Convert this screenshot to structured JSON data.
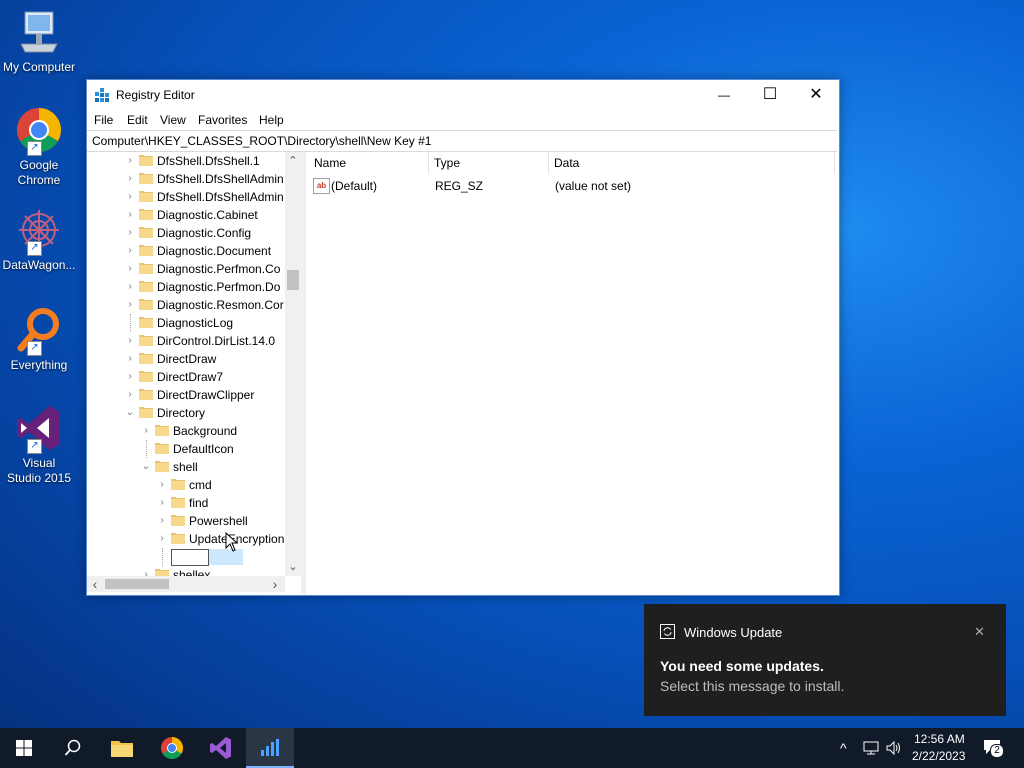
{
  "desktop": {
    "icons": [
      {
        "label": "My Computer",
        "icon": "computer-icon"
      },
      {
        "label": "Google Chrome",
        "icon": "chrome-icon"
      },
      {
        "label": "DataWagon...",
        "icon": "datawagon-icon"
      },
      {
        "label": "Everything",
        "icon": "everything-icon"
      },
      {
        "label": "Visual Studio 2015",
        "icon": "visual-studio-icon"
      }
    ]
  },
  "window": {
    "title": "Registry Editor",
    "controls": {
      "minimize": "—",
      "maximize": "☐",
      "close": "✕"
    },
    "menu": [
      "File",
      "Edit",
      "View",
      "Favorites",
      "Help"
    ],
    "address": "Computer\\HKEY_CLASSES_ROOT\\Directory\\shell\\New Key #1",
    "tree": [
      {
        "label": "DfsShell.DfsShell.1",
        "depth": 0,
        "expander": "›"
      },
      {
        "label": "DfsShell.DfsShellAdmin",
        "depth": 0,
        "expander": "›"
      },
      {
        "label": "DfsShell.DfsShellAdmin",
        "depth": 0,
        "expander": "›"
      },
      {
        "label": "Diagnostic.Cabinet",
        "depth": 0,
        "expander": "›"
      },
      {
        "label": "Diagnostic.Config",
        "depth": 0,
        "expander": "›"
      },
      {
        "label": "Diagnostic.Document",
        "depth": 0,
        "expander": "›"
      },
      {
        "label": "Diagnostic.Perfmon.Co",
        "depth": 0,
        "expander": "›"
      },
      {
        "label": "Diagnostic.Perfmon.Do",
        "depth": 0,
        "expander": "›"
      },
      {
        "label": "Diagnostic.Resmon.Cor",
        "depth": 0,
        "expander": "›"
      },
      {
        "label": "DiagnosticLog",
        "depth": 0,
        "expander": ""
      },
      {
        "label": "DirControl.DirList.14.0",
        "depth": 0,
        "expander": "›"
      },
      {
        "label": "DirectDraw",
        "depth": 0,
        "expander": "›"
      },
      {
        "label": "DirectDraw7",
        "depth": 0,
        "expander": "›"
      },
      {
        "label": "DirectDrawClipper",
        "depth": 0,
        "expander": "›"
      },
      {
        "label": "Directory",
        "depth": 0,
        "expander": "⌄"
      },
      {
        "label": "Background",
        "depth": 1,
        "expander": "›"
      },
      {
        "label": "DefaultIcon",
        "depth": 1,
        "expander": ""
      },
      {
        "label": "shell",
        "depth": 1,
        "expander": "⌄"
      },
      {
        "label": "cmd",
        "depth": 2,
        "expander": "›"
      },
      {
        "label": "find",
        "depth": 2,
        "expander": "›"
      },
      {
        "label": "Powershell",
        "depth": 2,
        "expander": "›"
      },
      {
        "label": "UpdateEncryption",
        "depth": 2,
        "expander": "›"
      },
      {
        "label": "",
        "depth": 2,
        "expander": "",
        "editing": true
      },
      {
        "label": "shellex",
        "depth": 1,
        "expander": "›"
      }
    ],
    "scroll": {
      "left": "‹",
      "right": "›",
      "up": "⌃",
      "down": "⌄"
    },
    "list": {
      "columns": [
        "Name",
        "Type",
        "Data"
      ],
      "rows": [
        {
          "name": "(Default)",
          "type": "REG_SZ",
          "data": "(value not set)"
        }
      ]
    }
  },
  "toast": {
    "app": "Windows Update",
    "title": "You need some updates.",
    "body": "Select this message to install.",
    "close": "✕"
  },
  "taskbar": {
    "apps": [
      "start-icon",
      "search-icon",
      "file-explorer-icon",
      "chrome-icon",
      "visual-studio-icon",
      "datawagon-icon"
    ],
    "tray": {
      "overflow": "^",
      "time": "12:56 AM",
      "date": "2/22/2023",
      "notifications": "2"
    }
  },
  "colors": {
    "accent": "#0078d7",
    "selection": "#cce8ff",
    "toast_bg": "#1f1f1f",
    "taskbar": "#101a28"
  }
}
